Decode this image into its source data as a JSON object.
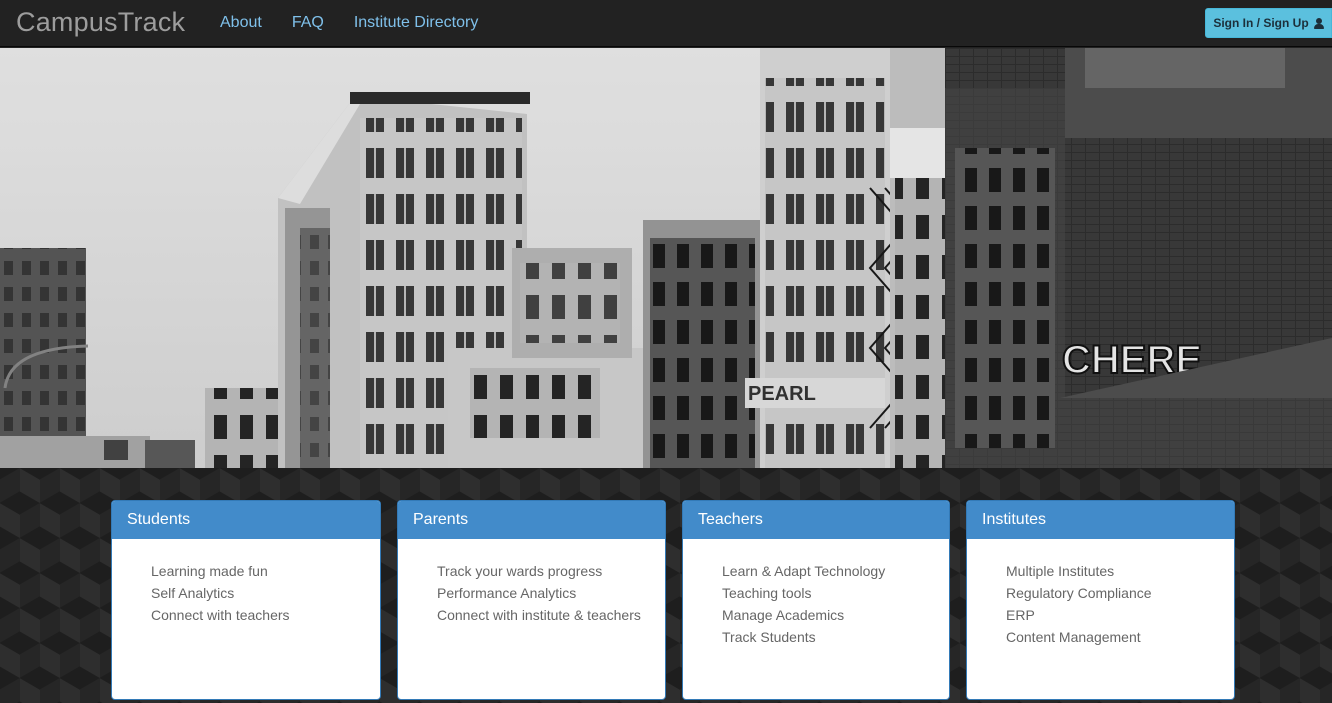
{
  "navbar": {
    "brand": "CampusTrack",
    "links": [
      "About",
      "FAQ",
      "Institute Directory"
    ],
    "signin_label": "Sign In / Sign Up"
  },
  "hero": {
    "description": "Black and white photograph of old city buildings with fire escapes and graffiti"
  },
  "panels": [
    {
      "title": "Students",
      "items": [
        "Learning made fun",
        "Self Analytics",
        "Connect with teachers"
      ]
    },
    {
      "title": "Parents",
      "items": [
        "Track your wards progress",
        "Performance Analytics",
        "Connect with institute & teachers"
      ]
    },
    {
      "title": "Teachers",
      "items": [
        "Learn & Adapt Technology",
        "Teaching tools",
        "Manage Academics",
        "Track Students"
      ]
    },
    {
      "title": "Institutes",
      "items": [
        "Multiple Institutes",
        "Regulatory Compliance",
        "ERP",
        "Content Management"
      ]
    }
  ],
  "colors": {
    "navbar_bg": "#222222",
    "nav_link": "#7fc0ea",
    "signin_bg": "#5bc0de",
    "panel_heading": "#428bca"
  }
}
